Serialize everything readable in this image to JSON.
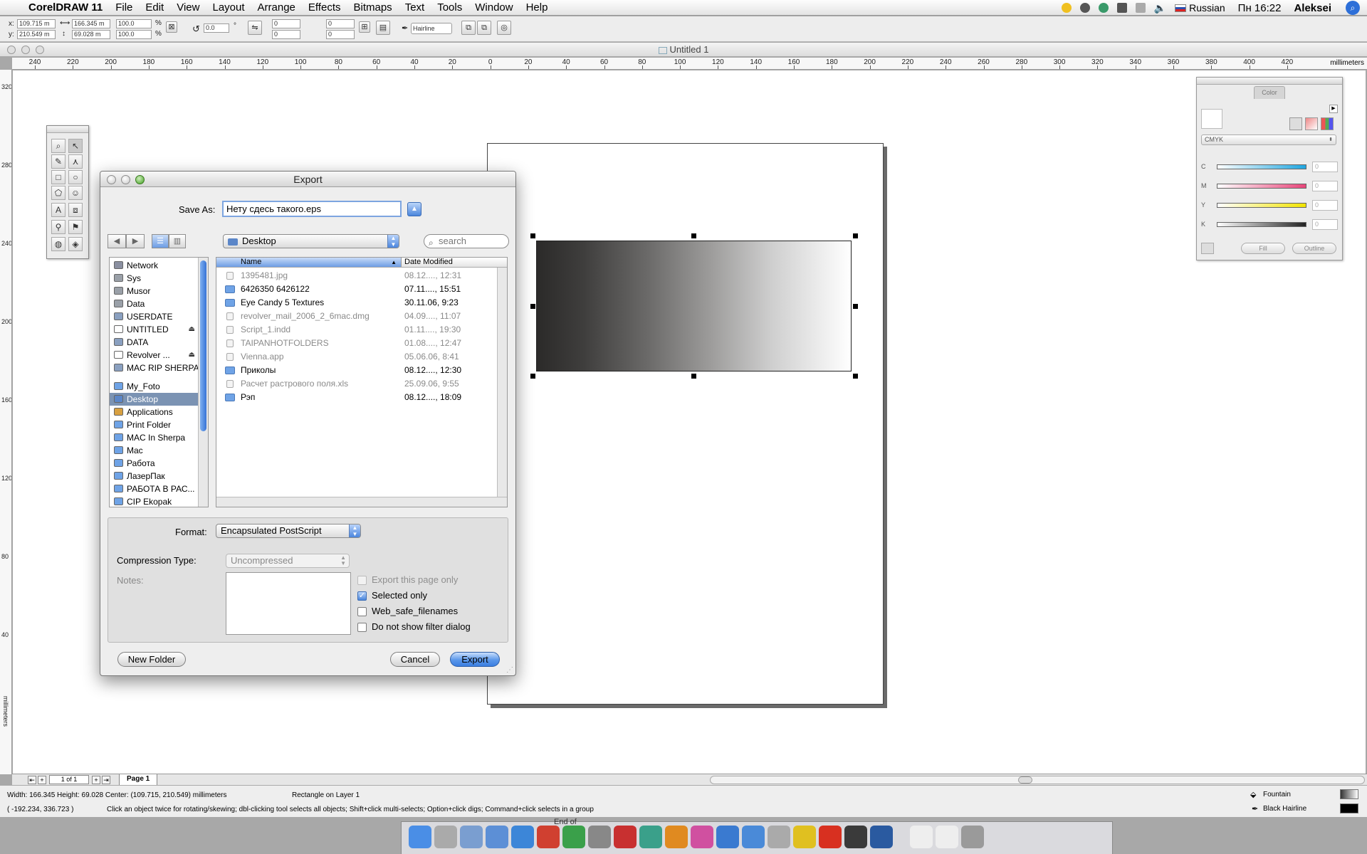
{
  "menubar": {
    "app_name": "CorelDRAW 11",
    "menus": [
      "File",
      "Edit",
      "View",
      "Layout",
      "Arrange",
      "Effects",
      "Bitmaps",
      "Text",
      "Tools",
      "Window",
      "Help"
    ],
    "language": "Russian",
    "clock": "Пн 16:22",
    "user": "Aleksei"
  },
  "propbar": {
    "x_label": "x:",
    "y_label": "y:",
    "x_value": "109.715 m",
    "y_value": "210.549 m",
    "width_value": "166.345 m",
    "height_value": "69.028 m",
    "scale_x": "100.0",
    "scale_y": "100.0",
    "percent": "%",
    "rotation": "0.0",
    "degree": "°",
    "corner_values": [
      "0",
      "0",
      "0",
      "0"
    ],
    "outline": "Hairline"
  },
  "document": {
    "title": "Untitled 1",
    "ruler_unit": "millimeters",
    "h_ruler_labels": [
      "240",
      "220",
      "200",
      "180",
      "160",
      "140",
      "120",
      "100",
      "80",
      "60",
      "40",
      "20",
      "0",
      "20",
      "40",
      "60",
      "80",
      "100",
      "120",
      "140",
      "160",
      "180",
      "200",
      "220",
      "240",
      "260",
      "280",
      "300",
      "320",
      "340",
      "360",
      "380",
      "400",
      "420"
    ],
    "v_ruler_labels": [
      "320",
      "280",
      "240",
      "200",
      "160",
      "120",
      "80",
      "40"
    ],
    "v_ruler_unit": "millimeters"
  },
  "color_docker": {
    "tab": "Color",
    "mode": "CMYK",
    "channels": [
      {
        "label": "C",
        "value": "0",
        "color": "#1fa6e0"
      },
      {
        "label": "M",
        "value": "0",
        "color": "#e8457a"
      },
      {
        "label": "Y",
        "value": "0",
        "color": "#f2e400"
      },
      {
        "label": "K",
        "value": "0",
        "color": "#222222"
      }
    ],
    "fill_label": "Fill",
    "outline_label": "Outline"
  },
  "dialog": {
    "title": "Export",
    "save_as_label": "Save As:",
    "save_as_value": "Нету сдесь такого.eps",
    "location": "Desktop",
    "search_placeholder": "search",
    "sidebar": [
      {
        "label": "Network",
        "icon": "globe-icon",
        "color": "#8a8fa0",
        "eject": ""
      },
      {
        "label": "Sys",
        "icon": "disk-icon",
        "color": "#9aa0a8",
        "eject": ""
      },
      {
        "label": "Musor",
        "icon": "disk-icon",
        "color": "#9aa0a8",
        "eject": ""
      },
      {
        "label": "Data",
        "icon": "disk-icon",
        "color": "#9aa0a8",
        "eject": ""
      },
      {
        "label": "USERDATE",
        "icon": "server-icon",
        "color": "#8aa0c0",
        "eject": ""
      },
      {
        "label": "UNTITLED",
        "icon": "blank-disk-icon",
        "color": "#ffffff",
        "eject": "⏏"
      },
      {
        "label": "DATA",
        "icon": "server-icon",
        "color": "#8aa0c0",
        "eject": ""
      },
      {
        "label": "Revolver ...",
        "icon": "blank-disk-icon",
        "color": "#ffffff",
        "eject": "⏏"
      },
      {
        "label": "MAC RIP SHERPA",
        "icon": "server-icon",
        "color": "#8aa0c0",
        "eject": ""
      },
      {
        "label": "My_Foto",
        "icon": "folder-icon",
        "color": "#6fa3e6",
        "eject": ""
      },
      {
        "label": "Desktop",
        "icon": "desktop-icon",
        "color": "#5b86c8",
        "eject": ""
      },
      {
        "label": "Applications",
        "icon": "applications-icon",
        "color": "#d8a040",
        "eject": ""
      },
      {
        "label": "Print Folder",
        "icon": "folder-icon",
        "color": "#6fa3e6",
        "eject": ""
      },
      {
        "label": "MAC In Sherpa",
        "icon": "folder-icon",
        "color": "#6fa3e6",
        "eject": ""
      },
      {
        "label": "Mac",
        "icon": "folder-icon",
        "color": "#6fa3e6",
        "eject": ""
      },
      {
        "label": "Работа",
        "icon": "folder-icon",
        "color": "#6fa3e6",
        "eject": ""
      },
      {
        "label": "ЛазерПак",
        "icon": "folder-icon",
        "color": "#6fa3e6",
        "eject": ""
      },
      {
        "label": "РАБОТА В РАС...",
        "icon": "folder-icon",
        "color": "#6fa3e6",
        "eject": ""
      },
      {
        "label": "CIP Ekopak",
        "icon": "folder-icon",
        "color": "#6fa3e6",
        "eject": ""
      }
    ],
    "selected_sidebar": "Desktop",
    "columns": {
      "name": "Name",
      "date": "Date Modified"
    },
    "files": [
      {
        "name": "1395481.jpg",
        "date": "08.12...., 12:31",
        "kind": "file",
        "dim": true
      },
      {
        "name": "6426350   6426122",
        "date": "07.11...., 15:51",
        "kind": "folder",
        "dim": false
      },
      {
        "name": "Eye Candy 5 Textures",
        "date": "30.11.06, 9:23",
        "kind": "folder",
        "dim": false
      },
      {
        "name": "revolver_mail_2006_2_6mac.dmg",
        "date": "04.09...., 11:07",
        "kind": "file",
        "dim": true
      },
      {
        "name": "Script_1.indd",
        "date": "01.11...., 19:30",
        "kind": "file",
        "dim": true
      },
      {
        "name": "TAIPANHOTFOLDERS",
        "date": "01.08...., 12:47",
        "kind": "file",
        "dim": true
      },
      {
        "name": "Vienna.app",
        "date": "05.06.06, 8:41",
        "kind": "file",
        "dim": true
      },
      {
        "name": "Приколы",
        "date": "08.12...., 12:30",
        "kind": "folder",
        "dim": false
      },
      {
        "name": "Расчет растрового поля.xls",
        "date": "25.09.06, 9:55",
        "kind": "file",
        "dim": true
      },
      {
        "name": "Рэп",
        "date": "08.12...., 18:09",
        "kind": "folder",
        "dim": false
      }
    ],
    "format_label": "Format:",
    "format_value": "Encapsulated PostScript",
    "compression_label": "Compression Type:",
    "compression_value": "Uncompressed",
    "notes_label": "Notes:",
    "checkboxes": [
      {
        "label": "Export this page only",
        "checked": false,
        "disabled": true
      },
      {
        "label": "Selected only",
        "checked": true,
        "disabled": false
      },
      {
        "label": "Web_safe_filenames",
        "checked": false,
        "disabled": false
      },
      {
        "label": "Do not show filter dialog",
        "checked": false,
        "disabled": false
      }
    ],
    "new_folder": "New Folder",
    "cancel": "Cancel",
    "export": "Export"
  },
  "pagetabs": {
    "counter": "1 of 1",
    "page": "Page 1"
  },
  "status": {
    "dimensions": "Width: 166.345  Height: 69.028  Center: (109.715, 210.549)  millimeters",
    "object": "Rectangle on Layer 1",
    "cursor": "( -192.234, 336.723 )",
    "hint": "Click an object twice for rotating/skewing; dbl-clicking tool selects all objects; Shift+click multi-selects; Option+click digs; Command+click selects in a group",
    "fill": "Fountain",
    "outline": "Black  Hairline"
  },
  "dock": {
    "label": "End of"
  }
}
